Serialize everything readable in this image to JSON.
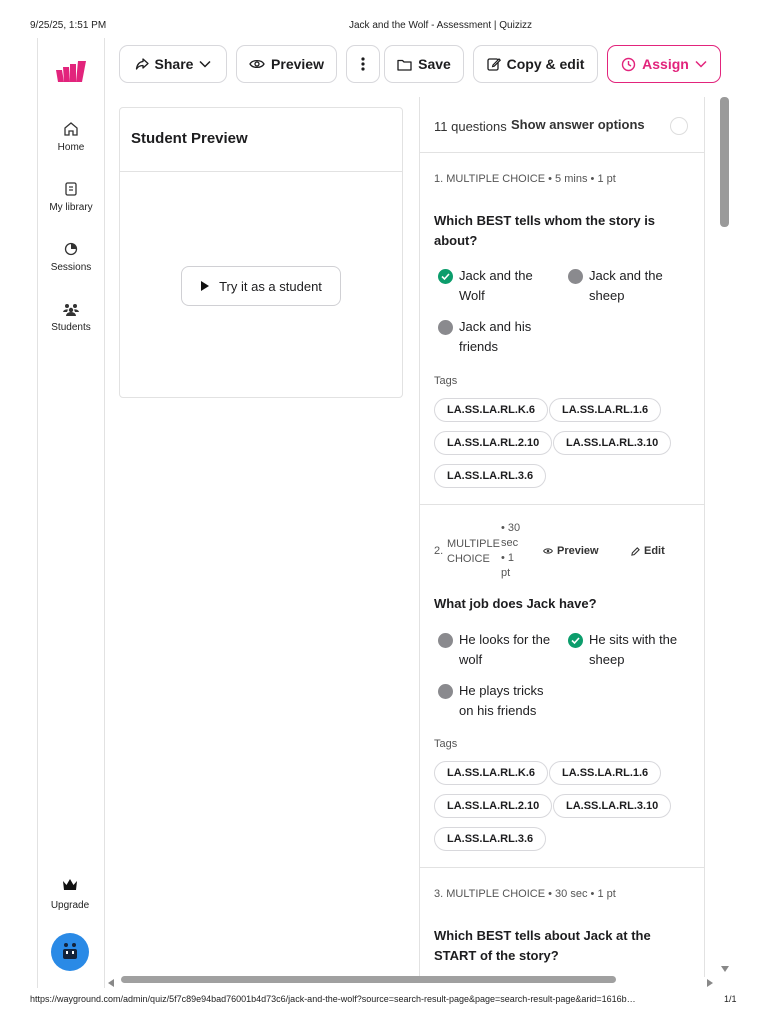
{
  "print_header": {
    "date": "9/25/25, 1:51 PM",
    "title": "Jack and the Wolf - Assessment | Quizizz"
  },
  "print_footer": {
    "url": "https://wayground.com/admin/quiz/5f7c89e94bad76001b4d73c6/jack-and-the-wolf?source=search-result-page&page=search-result-page&arid=1616b…",
    "page": "1/1"
  },
  "colors": {
    "brand": "#e2247c",
    "correct": "#0c9d6c",
    "neutral_dot": "#8a8a8e"
  },
  "sidebar": {
    "logo": "quizizz-logo",
    "items": [
      {
        "label": "Home",
        "icon": "home-icon"
      },
      {
        "label": "My library",
        "icon": "library-icon"
      },
      {
        "label": "Sessions",
        "icon": "sessions-icon"
      },
      {
        "label": "Students",
        "icon": "students-icon"
      }
    ],
    "upgrade_label": "Upgrade"
  },
  "toolbar": {
    "share": "Share",
    "preview": "Preview",
    "save": "Save",
    "copy_edit": "Copy & edit",
    "assign": "Assign"
  },
  "student_preview": {
    "title": "Student Preview",
    "try_button": "Try it as a student"
  },
  "questions_panel": {
    "count_label": "11 questions",
    "show_answers_label": "Show answer options",
    "tags_label": "Tags",
    "questions": [
      {
        "number": "1.",
        "type": "MULTIPLE CHOICE",
        "time": "5 mins",
        "points": "1 pt",
        "text": "Which BEST tells whom the story is about?",
        "options": [
          {
            "text": "Jack and the Wolf",
            "correct": true
          },
          {
            "text": "Jack and the sheep",
            "correct": false
          },
          {
            "text": "Jack and his friends",
            "correct": false
          }
        ],
        "tags": [
          "LA.SS.LA.RL.K.6",
          "LA.SS.LA.RL.1.6",
          "LA.SS.LA.RL.2.10",
          "LA.SS.LA.RL.3.10",
          "LA.SS.LA.RL.3.6"
        ]
      },
      {
        "number": "2.",
        "type_line1": "MULTIPLE",
        "type_line2": "CHOICE",
        "time_line1": "• 30",
        "time_line2": "sec",
        "points_line1": "• 1",
        "points_line2": "pt",
        "preview_label": "Preview",
        "edit_label": "Edit",
        "text": "What job does Jack have?",
        "options": [
          {
            "text": "He looks for the wolf",
            "correct": false
          },
          {
            "text": "He sits with the sheep",
            "correct": true
          },
          {
            "text": "He plays tricks on his friends",
            "correct": false
          }
        ],
        "tags": [
          "LA.SS.LA.RL.K.6",
          "LA.SS.LA.RL.1.6",
          "LA.SS.LA.RL.2.10",
          "LA.SS.LA.RL.3.10",
          "LA.SS.LA.RL.3.6"
        ]
      },
      {
        "number": "3.",
        "type": "MULTIPLE CHOICE",
        "time": "30 sec",
        "points": "1 pt",
        "text": "Which BEST tells about Jack at the START of the story?"
      }
    ]
  }
}
